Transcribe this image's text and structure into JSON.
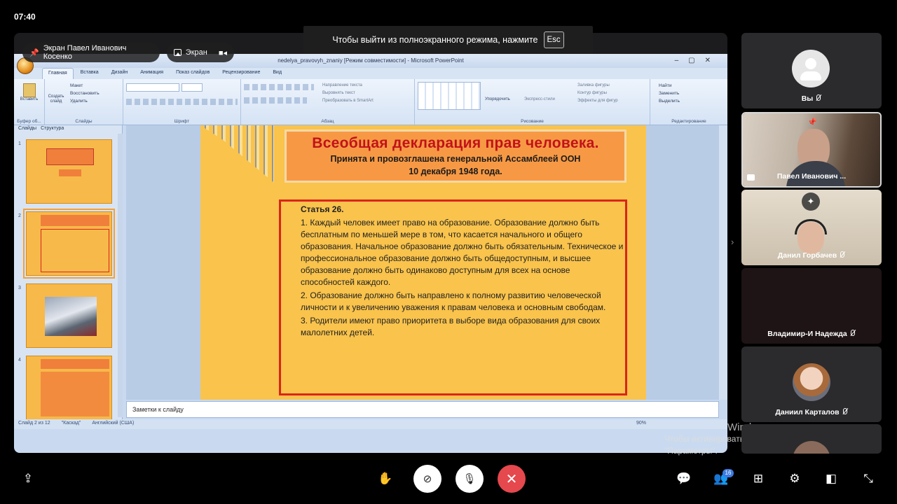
{
  "status_bar": {
    "time": "07:40"
  },
  "fullscreen_banner": {
    "text": "Чтобы выйти из полноэкранного режима, нажмите",
    "key": "Esc"
  },
  "stage": {
    "presenter_chip": "Экран Павел Иванович Косенко",
    "screen_chip": "Экран"
  },
  "powerpoint": {
    "window_title": "nedelya_pravovyh_znaniy [Режим совместимости] - Microsoft PowerPoint",
    "tabs": [
      "Главная",
      "Вставка",
      "Дизайн",
      "Анимация",
      "Показ слайдов",
      "Рецензирование",
      "Вид"
    ],
    "ribbon_groups": [
      "Буфер об...",
      "Слайды",
      "Шрифт",
      "Абзац",
      "Рисование",
      "Редактирование"
    ],
    "ribbon_buttons": {
      "paste": "Вставить",
      "new_slide": "Создать слайд",
      "layout": "Макет",
      "reset": "Восстановить",
      "delete": "Удалить",
      "text_direction": "Направление текста",
      "align_text": "Выровнять текст",
      "smartart": "Преобразовать в SmartArt",
      "arrange": "Упорядочить",
      "quick_styles": "Экспресс-стили",
      "shape_fill": "Заливка фигуры",
      "shape_outline": "Контур фигуры",
      "shape_effects": "Эффекты для фигур",
      "find": "Найти",
      "replace": "Заменить",
      "select": "Выделить"
    },
    "panel_tabs": [
      "Слайды",
      "Структура"
    ],
    "thumb_numbers": [
      "1",
      "2",
      "3",
      "4"
    ],
    "slide": {
      "title": "Всеобщая декларация прав человека.",
      "subtitle_line1": "Принята и провозглашена генеральной Ассамблеей ООН",
      "subtitle_line2": "10 декабря 1948 года.",
      "article_title": "Статья 26.",
      "p1": "1. Каждый человек имеет право на образование. Образование должно быть бесплатным по меньшей мере в том, что касается начального и общего образования. Начальное образование должно быть обязательным. Техническое и профессиональное образование должно быть общедоступным, и высшее образование должно быть одинаково доступным для всех на основе способностей каждого.",
      "p2": "2. Образование должно быть направлено к полному развитию человеческой личности и к увеличению уважения к правам человека и основным свободам.",
      "p3": "3. Родители имеют право приоритета в выборе вида образования для своих малолетних детей."
    },
    "notes_placeholder": "Заметки к слайду",
    "status": {
      "slide_counter": "Слайд 2 из 12",
      "theme": "\"Каскад\"",
      "language": "Английский (США)",
      "zoom": "90%"
    }
  },
  "windows_watermark": {
    "title": "Windows",
    "line1": "Чтобы активировать Windows, перейдите в раздел",
    "line2": "\"Параметры\"."
  },
  "participants": [
    {
      "name": "Вы",
      "muted": true
    },
    {
      "name": "Павел Иванович ...",
      "muted": false,
      "pinned": true
    },
    {
      "name": "Данил Горбачев",
      "muted": true
    },
    {
      "name": "Владимир-И Надежда",
      "muted": true
    },
    {
      "name": "Даниил Карталов",
      "muted": true
    }
  ],
  "toolbar": {
    "participants_count": "16",
    "colors": {
      "end_call": "#e5484d",
      "badge": "#3d7be0"
    }
  }
}
